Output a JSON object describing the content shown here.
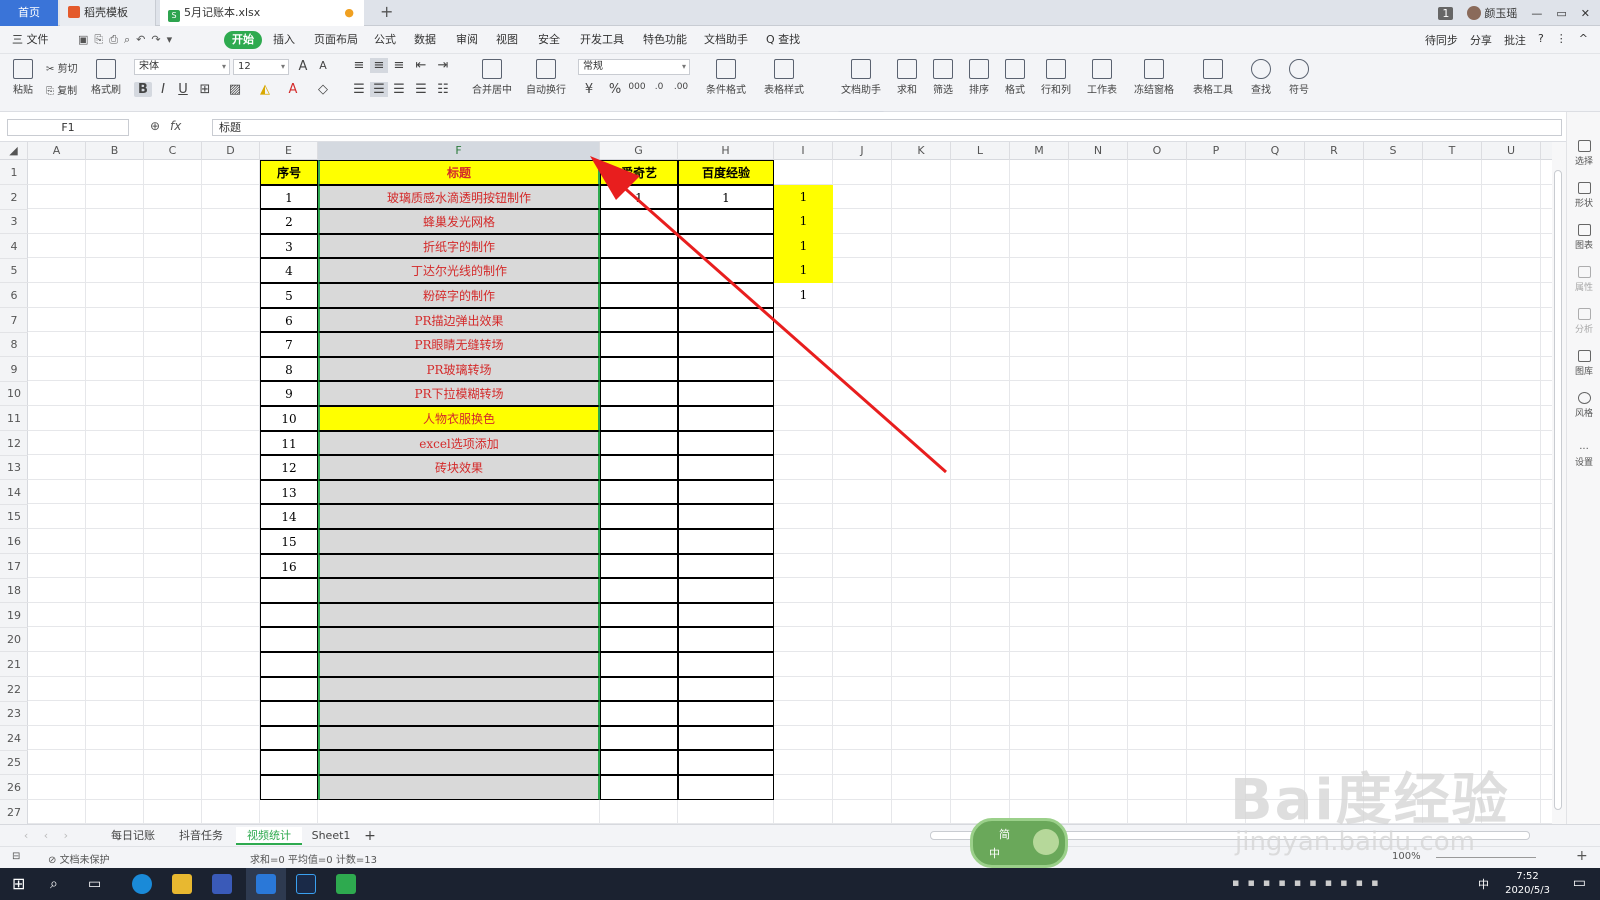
{
  "window": {
    "tabs": [
      {
        "label": "首页"
      },
      {
        "label": "稻壳模板"
      },
      {
        "label": "5月记账本.xlsx",
        "modified_mark": "●"
      }
    ],
    "add_tab": "+",
    "badge": "1",
    "user": "颜玉瑶",
    "controls": [
      "—",
      "▭",
      "✕"
    ]
  },
  "menu": {
    "file": "三 文件",
    "items": [
      "开始",
      "插入",
      "页面布局",
      "公式",
      "数据",
      "审阅",
      "视图",
      "安全",
      "开发工具",
      "特色功能",
      "文档助手"
    ],
    "search": "Q 查找",
    "right": [
      "待同步",
      "分享",
      "批注",
      "?",
      "⋮",
      "^"
    ]
  },
  "ribbon": {
    "paste": "粘贴",
    "cut": "剪切",
    "copy": "复制",
    "format_painter": "格式刷",
    "font": "宋体",
    "font_size": "12",
    "bold": "B",
    "italic": "I",
    "underline": "U",
    "merge": "合并居中",
    "wrap": "自动换行",
    "number_format": "常规",
    "percent": "%",
    "cond_format": "条件格式",
    "table_style": "表格样式",
    "doc_helper": "文档助手",
    "sum": "求和",
    "filter": "筛选",
    "sort": "排序",
    "format": "格式",
    "rows_cols": "行和列",
    "worksheet": "工作表",
    "freeze": "冻结窗格",
    "table_tools": "表格工具",
    "find": "查找",
    "symbol": "符号"
  },
  "formula_bar": {
    "name_box": "F1",
    "fx": "fx",
    "value": "标题"
  },
  "grid": {
    "columns": [
      "A",
      "B",
      "C",
      "D",
      "E",
      "F",
      "G",
      "H",
      "I",
      "J",
      "K",
      "L",
      "M",
      "N",
      "O",
      "P",
      "Q",
      "R",
      "S",
      "T",
      "U"
    ],
    "rows": [
      "1",
      "2",
      "3",
      "4",
      "5",
      "6",
      "7",
      "8",
      "9",
      "10",
      "11",
      "12",
      "13",
      "14",
      "15",
      "16",
      "17",
      "18",
      "19",
      "20",
      "21",
      "22",
      "23",
      "24",
      "25",
      "26",
      "27"
    ],
    "headers": {
      "seq": "序号",
      "title": "标题",
      "iqiyi": "爱奇艺",
      "baidu": "百度经验"
    },
    "data": [
      {
        "seq": "1",
        "title": "玻璃质感水滴透明按钮制作",
        "iqiyi": "1",
        "baidu": "1",
        "i": "1"
      },
      {
        "seq": "2",
        "title": "蜂巢发光网格",
        "i": "1"
      },
      {
        "seq": "3",
        "title": "折纸字的制作",
        "i": "1"
      },
      {
        "seq": "4",
        "title": "丁达尔光线的制作",
        "i": "1"
      },
      {
        "seq": "5",
        "title": "粉碎字的制作",
        "i": "1"
      },
      {
        "seq": "6",
        "title": "PR描边弹出效果"
      },
      {
        "seq": "7",
        "title": "PR眼睛无缝转场"
      },
      {
        "seq": "8",
        "title": "PR玻璃转场"
      },
      {
        "seq": "9",
        "title": "PR下拉模糊转场"
      },
      {
        "seq": "10",
        "title": "人物衣服换色"
      },
      {
        "seq": "11",
        "title": "excel选项添加"
      },
      {
        "seq": "12",
        "title": "砖块效果"
      },
      {
        "seq": "13",
        "title": ""
      },
      {
        "seq": "14",
        "title": ""
      },
      {
        "seq": "15",
        "title": ""
      },
      {
        "seq": "16",
        "title": ""
      }
    ]
  },
  "sheets": [
    "每日记账",
    "抖音任务",
    "视频统计",
    "Sheet1"
  ],
  "add_sheet": "+",
  "status": {
    "protect": "文档未保护",
    "stats": "求和=0  平均值=0  计数=13",
    "zoom": "100%"
  },
  "right_pane": [
    "选择",
    "形状",
    "图表",
    "属性",
    "分析",
    "图库",
    "风格",
    "设置"
  ],
  "taskbar": {
    "time": "7:52",
    "date": "2020/5/3",
    "ime": "中"
  },
  "widget": {
    "top": "简",
    "bottom": "中"
  },
  "watermark": {
    "line1": "Bai度经验",
    "line2": "jingyan.baidu.com"
  },
  "colors": {
    "accent": "#2eaa4f",
    "yellow": "#ffff00",
    "title_red": "#d42a2a",
    "gray_col": "#d9d9d9",
    "arrow": "#e81e1e"
  }
}
